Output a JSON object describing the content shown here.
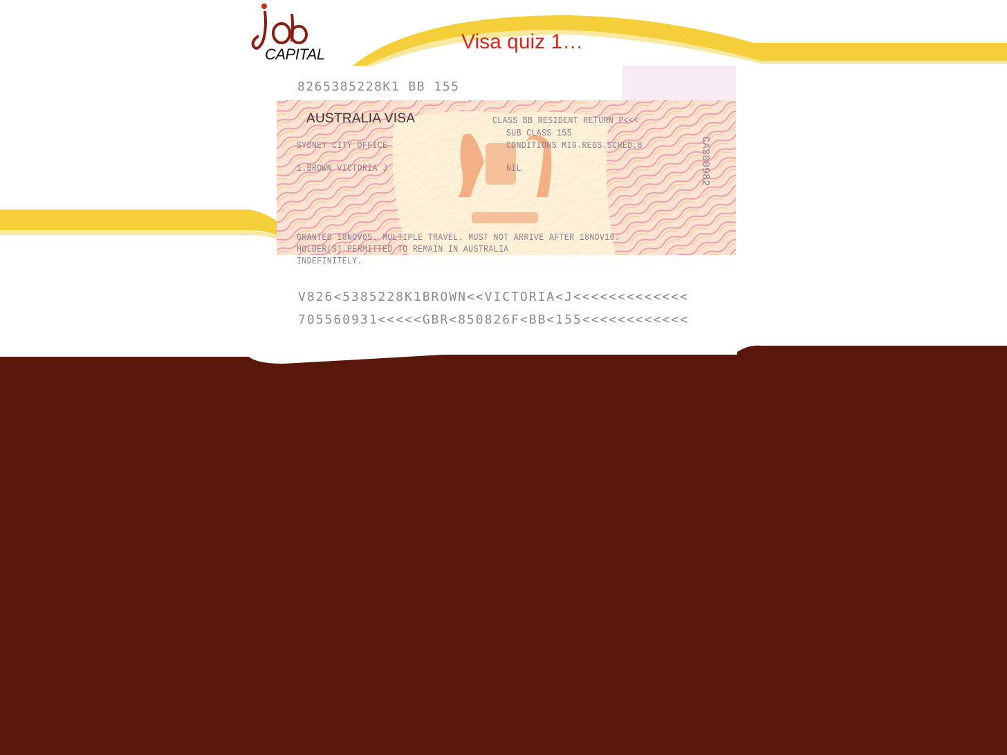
{
  "slide": {
    "title": "Visa quiz 1…",
    "colors": {
      "maroon": "#5a170c",
      "gold": "#f4cf3a",
      "title_red": "#d42a1a"
    }
  },
  "logo": {
    "name": "job-capital-logo",
    "word": "CAPITAL"
  },
  "visa": {
    "number_top": "8265385228K1 BB 155",
    "heading": "AUSTRALIA  VISA",
    "class_line": "CLASS BB RESIDENT RETURN P<<<",
    "subclass_line": "SUB CLASS 155",
    "conditions_line": "CONDITIONS MIG.REGS.SCHED.8",
    "office": "SYDNEY CITY OFFICE",
    "holder": "1.BROWN VICTORIA J",
    "conditions_value": "NIL",
    "serial": "CA300982",
    "grant_line_1": "GRANTED 18NOV05. MULTIPLE TRAVEL. MUST NOT ARRIVE AFTER 18NOV10.",
    "grant_line_2": "HOLDER(S) PERMITTED TO REMAIN IN AUSTRALIA",
    "grant_line_3": "INDEFINITELY.",
    "mrz_line_1": "V826<5385228K1BROWN<<VICTORIA<J<<<<<<<<<<<<<",
    "mrz_line_2": "705560931<<<<<GBR<850826F<BB<155<<<<<<<<<<<<"
  }
}
